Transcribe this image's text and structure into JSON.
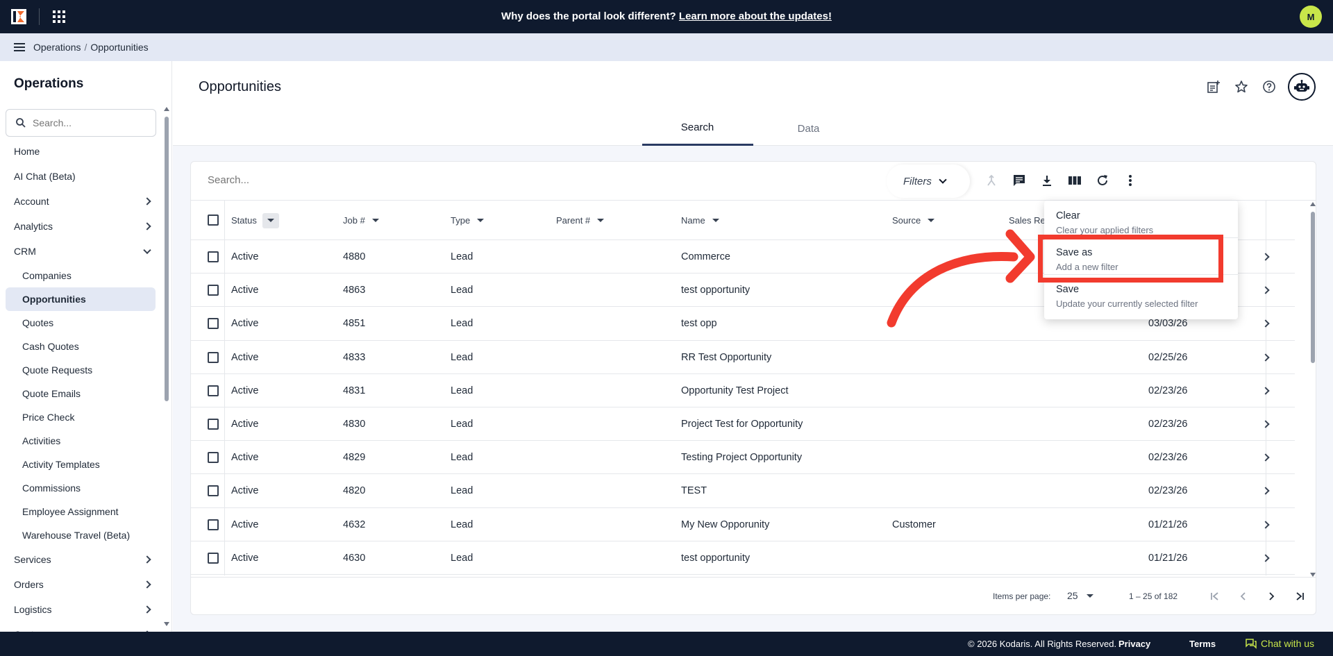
{
  "banner": {
    "text": "Why does the portal look different?",
    "link": "Learn more about the updates!",
    "avatar_initial": "M",
    "avatar_color": "#c8e64a"
  },
  "breadcrumb": [
    "Operations",
    "/",
    "Opportunities"
  ],
  "sidebar": {
    "title": "Operations",
    "search_placeholder": "Search...",
    "items": [
      {
        "label": "Home",
        "level": "top"
      },
      {
        "label": "AI Chat (Beta)",
        "level": "top"
      },
      {
        "label": "Account",
        "level": "top",
        "expandable": true
      },
      {
        "label": "Analytics",
        "level": "top",
        "expandable": true
      },
      {
        "label": "CRM",
        "level": "top",
        "expanded": true
      },
      {
        "label": "Companies",
        "level": "sub"
      },
      {
        "label": "Opportunities",
        "level": "sub",
        "active": true
      },
      {
        "label": "Quotes",
        "level": "sub"
      },
      {
        "label": "Cash Quotes",
        "level": "sub"
      },
      {
        "label": "Quote Requests",
        "level": "sub"
      },
      {
        "label": "Quote Emails",
        "level": "sub"
      },
      {
        "label": "Price Check",
        "level": "sub"
      },
      {
        "label": "Activities",
        "level": "sub"
      },
      {
        "label": "Activity Templates",
        "level": "sub"
      },
      {
        "label": "Commissions",
        "level": "sub"
      },
      {
        "label": "Employee Assignment",
        "level": "sub"
      },
      {
        "label": "Warehouse Travel (Beta)",
        "level": "sub"
      },
      {
        "label": "Services",
        "level": "top",
        "expandable": true
      },
      {
        "label": "Orders",
        "level": "top",
        "expandable": true
      },
      {
        "label": "Logistics",
        "level": "top",
        "expandable": true
      },
      {
        "label": "Customers",
        "level": "top",
        "expandable": true
      }
    ]
  },
  "page": {
    "title": "Opportunities",
    "tabs": [
      {
        "label": "Search",
        "active": true
      },
      {
        "label": "Data",
        "active": false
      }
    ]
  },
  "toolbar": {
    "search_placeholder": "Search...",
    "filters_label": "Filters"
  },
  "table": {
    "columns": [
      "Status",
      "Job #",
      "Type",
      "Parent #",
      "Name",
      "Source",
      "Sales Rep"
    ],
    "rows": [
      {
        "status": "Active",
        "job": "4880",
        "type": "Lead",
        "parent": "",
        "name": "Commerce",
        "source": "",
        "date": ""
      },
      {
        "status": "Active",
        "job": "4863",
        "type": "Lead",
        "parent": "",
        "name": "test opportunity",
        "source": "",
        "date": ""
      },
      {
        "status": "Active",
        "job": "4851",
        "type": "Lead",
        "parent": "",
        "name": "test opp",
        "source": "",
        "date": "03/03/26"
      },
      {
        "status": "Active",
        "job": "4833",
        "type": "Lead",
        "parent": "",
        "name": "RR Test Opportunity",
        "source": "",
        "date": "02/25/26"
      },
      {
        "status": "Active",
        "job": "4831",
        "type": "Lead",
        "parent": "",
        "name": "Opportunity Test Project",
        "source": "",
        "date": "02/23/26"
      },
      {
        "status": "Active",
        "job": "4830",
        "type": "Lead",
        "parent": "",
        "name": "Project Test for Opportunity",
        "source": "",
        "date": "02/23/26"
      },
      {
        "status": "Active",
        "job": "4829",
        "type": "Lead",
        "parent": "",
        "name": "Testing Project Opportunity",
        "source": "",
        "date": "02/23/26"
      },
      {
        "status": "Active",
        "job": "4820",
        "type": "Lead",
        "parent": "",
        "name": "TEST",
        "source": "",
        "date": "02/23/26"
      },
      {
        "status": "Active",
        "job": "4632",
        "type": "Lead",
        "parent": "",
        "name": "My New Opporunity",
        "source": "Customer",
        "date": "01/21/26"
      },
      {
        "status": "Active",
        "job": "4630",
        "type": "Lead",
        "parent": "",
        "name": "test opportunity",
        "source": "",
        "date": "01/21/26"
      }
    ]
  },
  "paginator": {
    "items_per_page_label": "Items per page:",
    "page_size": "25",
    "range": "1 – 25 of 182"
  },
  "filter_menu": {
    "items": [
      {
        "title": "Clear",
        "subtitle": "Clear your applied filters"
      },
      {
        "title": "Save as",
        "subtitle": "Add a new filter",
        "highlighted": true
      },
      {
        "title": "Save",
        "subtitle": "Update your currently selected filter"
      }
    ],
    "highlight_color": "#f23b2e"
  },
  "footer": {
    "copyright": "© 2026 Kodaris. All Rights Reserved.",
    "privacy": "Privacy",
    "terms": "Terms",
    "chat": "Chat with us"
  },
  "colors": {
    "navy": "#0f1a2e",
    "lime": "#c8e64a",
    "nav_bg": "#e3e8f4",
    "annotation_red": "#f23b2e"
  }
}
